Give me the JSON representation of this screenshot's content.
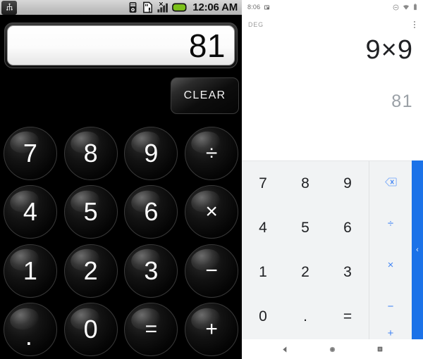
{
  "left_phone": {
    "status_bar": {
      "clock": "12:06 AM",
      "icons": [
        "usb-icon",
        "sync-download-icon",
        "sd-card-warning-icon",
        "signal-bars-icon",
        "battery-icon"
      ]
    },
    "display_value": "81",
    "clear_label": "CLEAR",
    "keypad": [
      {
        "label": "7",
        "kind": "digit",
        "name": "key-7"
      },
      {
        "label": "8",
        "kind": "digit",
        "name": "key-8"
      },
      {
        "label": "9",
        "kind": "digit",
        "name": "key-9"
      },
      {
        "label": "÷",
        "kind": "op",
        "name": "key-divide"
      },
      {
        "label": "4",
        "kind": "digit",
        "name": "key-4"
      },
      {
        "label": "5",
        "kind": "digit",
        "name": "key-5"
      },
      {
        "label": "6",
        "kind": "digit",
        "name": "key-6"
      },
      {
        "label": "×",
        "kind": "op",
        "name": "key-multiply"
      },
      {
        "label": "1",
        "kind": "digit",
        "name": "key-1"
      },
      {
        "label": "2",
        "kind": "digit",
        "name": "key-2"
      },
      {
        "label": "3",
        "kind": "digit",
        "name": "key-3"
      },
      {
        "label": "−",
        "kind": "op",
        "name": "key-minus"
      },
      {
        "label": ".",
        "kind": "dot",
        "name": "key-decimal"
      },
      {
        "label": "0",
        "kind": "digit",
        "name": "key-0"
      },
      {
        "label": "=",
        "kind": "op",
        "name": "key-equals"
      },
      {
        "label": "+",
        "kind": "op",
        "name": "key-plus"
      }
    ]
  },
  "right_phone": {
    "status_bar": {
      "time": "8:06",
      "left_icons": [
        "screenshot-icon"
      ],
      "right_icons": [
        "do-not-disturb-icon",
        "wifi-icon",
        "battery-icon"
      ]
    },
    "toolbar": {
      "angle_unit": "DEG",
      "overflow_label": "overflow-menu"
    },
    "formula": "9×9",
    "result": "81",
    "digits": [
      {
        "label": "7",
        "name": "key-7"
      },
      {
        "label": "8",
        "name": "key-8"
      },
      {
        "label": "9",
        "name": "key-9"
      },
      {
        "label": "4",
        "name": "key-4"
      },
      {
        "label": "5",
        "name": "key-5"
      },
      {
        "label": "6",
        "name": "key-6"
      },
      {
        "label": "1",
        "name": "key-1"
      },
      {
        "label": "2",
        "name": "key-2"
      },
      {
        "label": "3",
        "name": "key-3"
      },
      {
        "label": "0",
        "name": "key-0"
      },
      {
        "label": ".",
        "name": "key-decimal"
      },
      {
        "label": "=",
        "name": "key-equals"
      }
    ],
    "operators": [
      {
        "label": "",
        "name": "key-backspace",
        "icon": "backspace-icon"
      },
      {
        "label": "÷",
        "name": "key-divide",
        "icon": ""
      },
      {
        "label": "×",
        "name": "key-multiply",
        "icon": ""
      },
      {
        "label": "−",
        "name": "key-minus",
        "icon": ""
      },
      {
        "label": "+",
        "name": "key-plus",
        "icon": ""
      }
    ],
    "panel_toggle": "‹",
    "nav_bar": [
      "back-icon",
      "home-icon",
      "recents-icon"
    ],
    "colors": {
      "accent_blue": "#1b72e8",
      "operator_blue": "#4285f4",
      "keypad_bg": "#f1f3f4",
      "result_gray": "#9aa0a6"
    }
  }
}
